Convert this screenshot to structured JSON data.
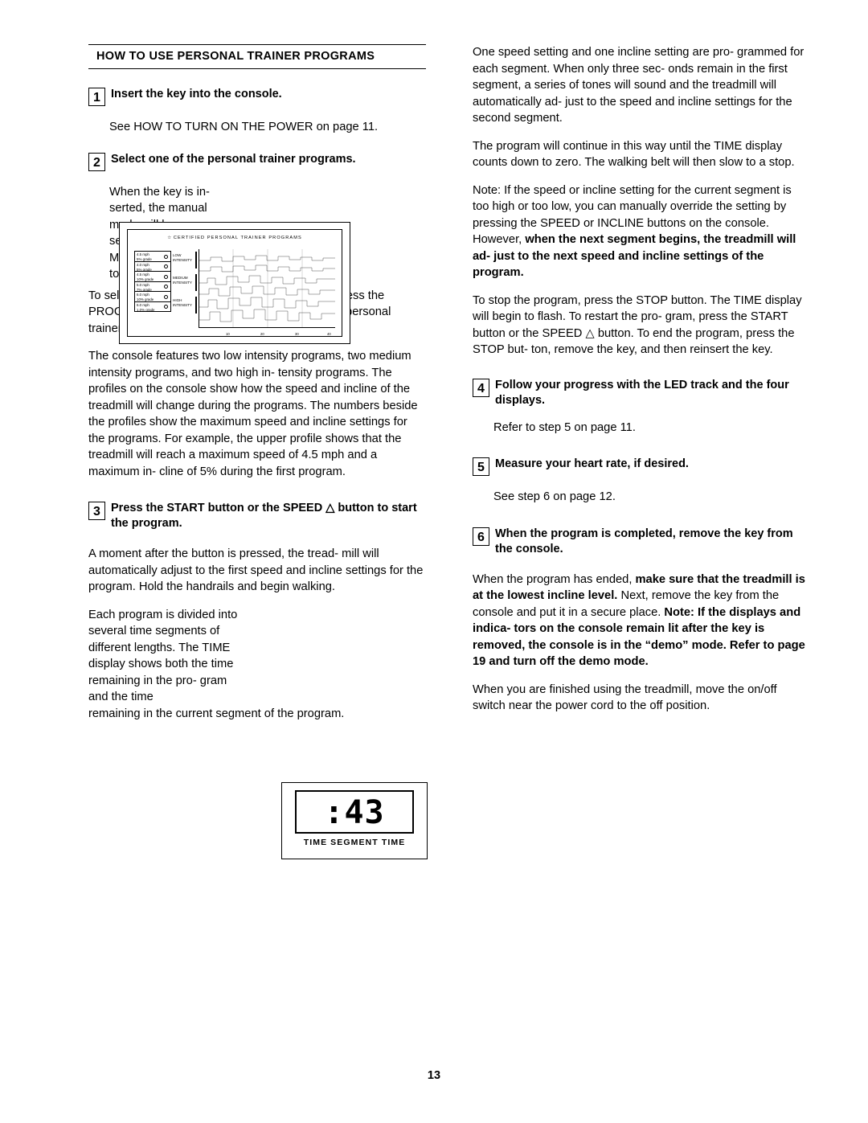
{
  "document": {
    "section_title": "HOW TO USE PERSONAL TRAINER PROGRAMS",
    "page_number": "13"
  },
  "left_column": {
    "step1": {
      "number": "1",
      "heading": "Insert the key into the console.",
      "body": "See HOW TO TURN ON THE POWER on page 11."
    },
    "step2": {
      "number": "2",
      "heading": "Select one of the personal trainer programs.",
      "wrap_text": "When the key is in- serted, the manual mode will be selected and the MAN- UAL indica- tor will light.",
      "para1": "To select one of the personal trainer programs, press the PROGRAM button repeatedly until one of the six personal trainer program indicators lights.",
      "para2": "The console features two low intensity programs, two medium intensity programs, and two high in- tensity programs. The profiles on the console show how the speed and incline of the treadmill will change during the programs. The numbers beside the profiles show the maximum speed and incline settings for the programs. For example, the upper profile shows that the treadmill will reach a maximum speed of 4.5 mph and a maximum in- cline of 5% during the first program."
    },
    "step3": {
      "number": "3",
      "heading_part1": "Press the START button or the SPEED ",
      "heading_symbol": "△",
      "heading_part2": " button to start the program.",
      "para1": "A moment after the button is pressed, the tread- mill will automatically adjust to the first speed and incline settings for the program. Hold the handrails and begin walking.",
      "para2_wrap": "Each program is divided into several time segments of different lengths. The TIME display shows both the time remaining in the pro- gram and the time",
      "para2_rest": "remaining in the current segment of the program."
    }
  },
  "right_column": {
    "para1": "One speed setting and one incline setting are pro- grammed for each segment. When only three sec- onds remain in the first segment, a series of tones will sound and the treadmill will automatically ad- just to the speed and incline settings for the second segment.",
    "para2": "The program will continue in this way until the TIME display counts down to zero. The walking belt will then slow to a stop.",
    "para3_normal": "Note: If the speed or incline setting for the current segment is too high or too low, you can manually override the setting by pressing the SPEED or INCLINE buttons on the console. However, ",
    "para3_bold": "when the next segment begins, the treadmill will ad- just to the next speed and incline settings of the program.",
    "para4_a": "To stop the program, press the STOP button. The TIME display will begin to flash. To restart the pro- gram, press the START button or the SPEED ",
    "para4_symbol": "△",
    "para4_b": " button. To end the program, press the STOP but- ton, remove the key, and then reinsert the key.",
    "step4": {
      "number": "4",
      "heading": "Follow your progress with the LED track and the four displays.",
      "body": "Refer to step 5 on page 11."
    },
    "step5": {
      "number": "5",
      "heading": "Measure your heart rate, if desired.",
      "body": "See step 6 on page 12."
    },
    "step6": {
      "number": "6",
      "heading": "When the program is completed, remove the key from the console.",
      "para1_n1": "When the program has ended, ",
      "para1_b1": "make sure that the treadmill is at the lowest incline level.",
      "para1_n2": " Next, remove the key from the console and put it in a secure place. ",
      "para1_b2": "Note: If the displays and indica- tors on the console remain lit after the key is removed, the console is in the “demo” mode. Refer to page 19 and turn off the demo mode.",
      "para2": "When you are finished using the treadmill, move the on/off switch near the power cord to the off position."
    }
  },
  "console_figure": {
    "title": "CERTIFIED PERSONAL TRAINER PROGRAMS",
    "title_star": "☆",
    "speed_rows": [
      {
        "speed": "4.5 mph",
        "grade": "5% grade"
      },
      {
        "speed": "4.0 mph",
        "grade": "5% grade"
      },
      {
        "speed": "4.5 mph",
        "grade": "10% grade"
      },
      {
        "speed": "5.0 mph",
        "grade": "7% grade"
      },
      {
        "speed": "6.0 mph",
        "grade": "10% grade"
      },
      {
        "speed": "6.0 mph",
        "grade": "1.0% grade"
      }
    ],
    "intensity_labels": [
      {
        "line1": "LOW",
        "line2": "INTENSITY"
      },
      {
        "line1": "MEDIUM",
        "line2": "INTENSITY"
      },
      {
        "line1": "HIGH",
        "line2": "INTENSITY"
      }
    ],
    "x_axis_ticks": [
      "10",
      "20",
      "30",
      "40"
    ]
  },
  "time_figure": {
    "digits": ":43",
    "label": "TIME   SEGMENT TIME"
  }
}
